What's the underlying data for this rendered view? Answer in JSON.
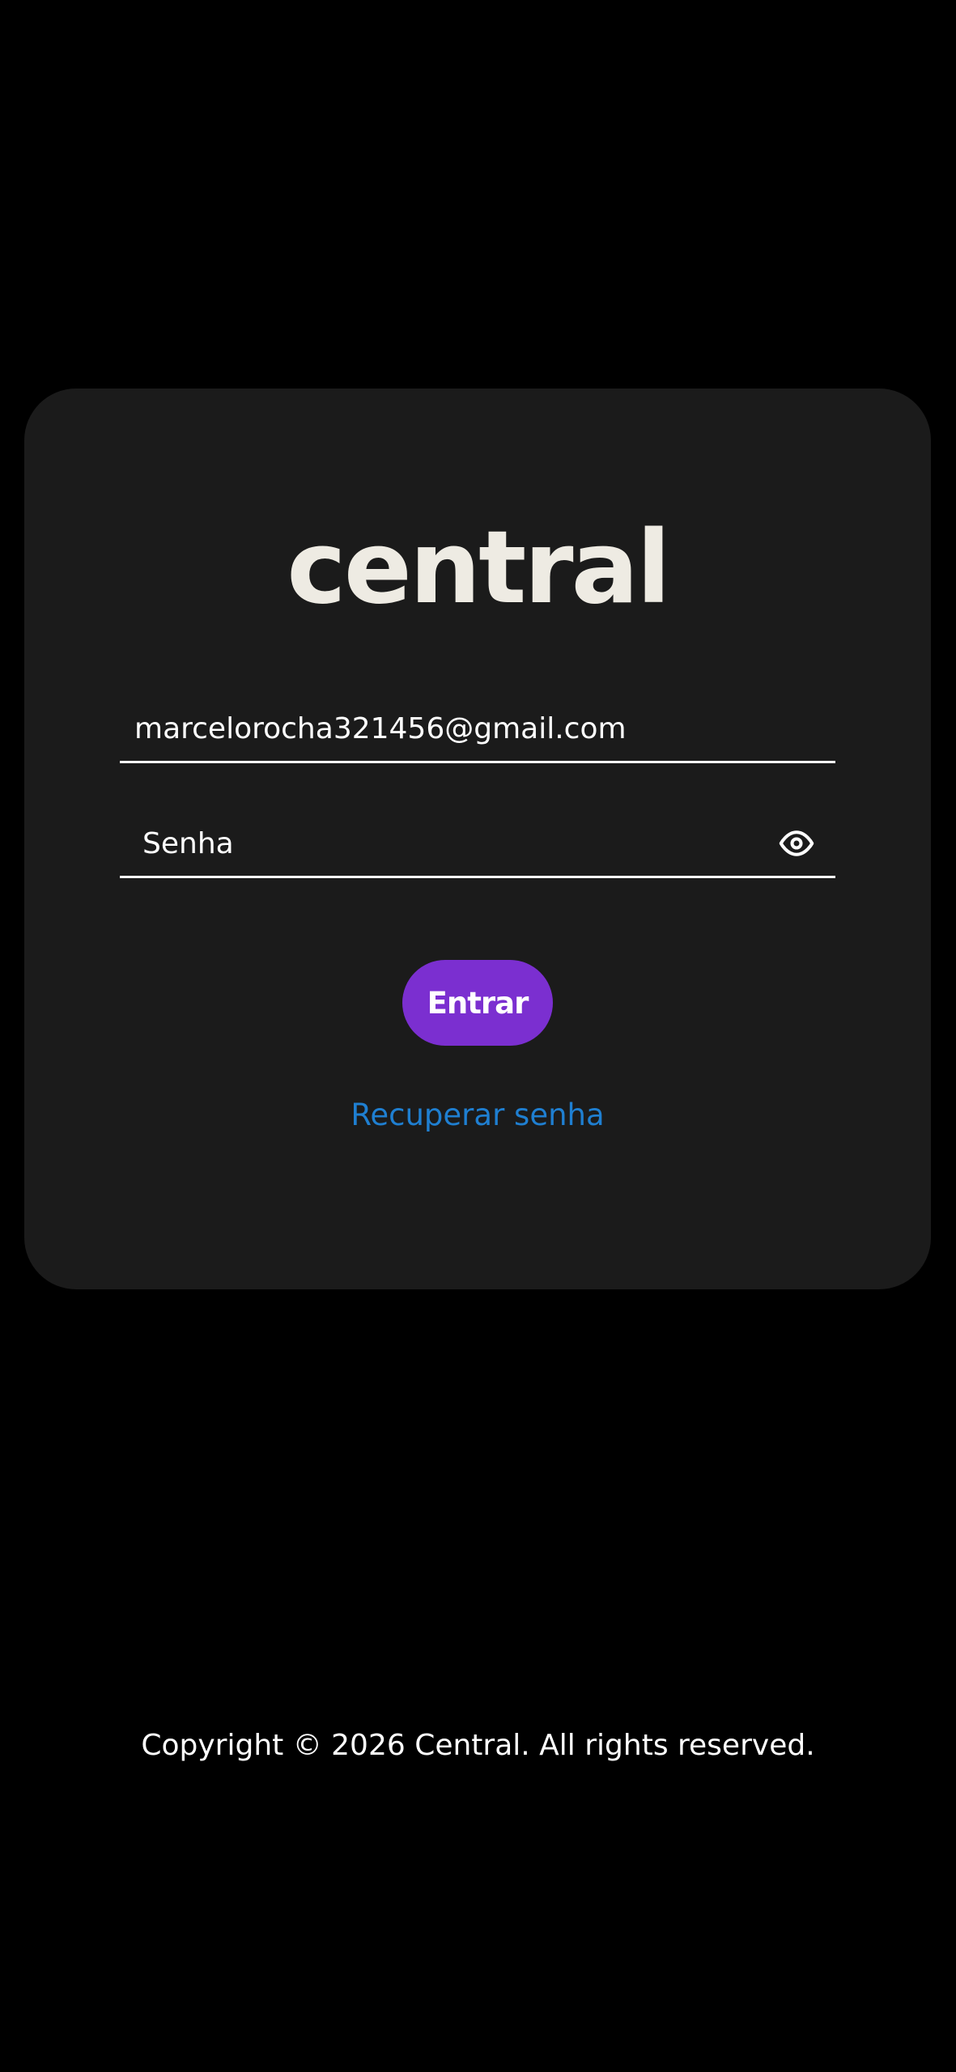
{
  "app": {
    "brand": "central"
  },
  "login": {
    "email_value": "marcelorocha321456@gmail.com",
    "password_placeholder": "Senha",
    "password_visibility_icon": "eye-icon",
    "submit_label": "Entrar",
    "recover_label": "Recuperar senha"
  },
  "footer": {
    "copyright": "Copyright © 2026 Central. All rights reserved."
  },
  "colors": {
    "background": "#000000",
    "card": "#1b1b1b",
    "accent": "#7b2fd0",
    "link": "#1f7fd1",
    "logo": "#eeebe3"
  }
}
